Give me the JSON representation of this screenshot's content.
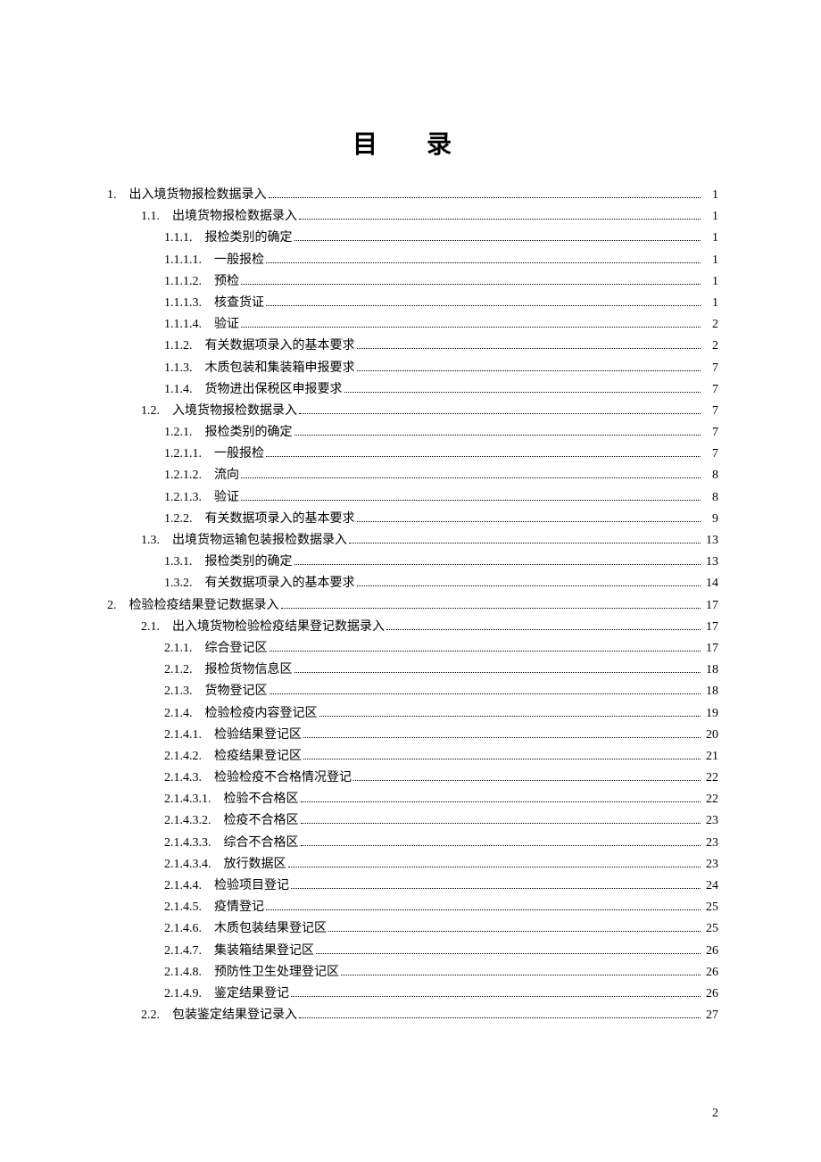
{
  "title": "目 录",
  "page_number": "2",
  "toc": [
    {
      "indent": 0,
      "num": "1.",
      "label": "出入境货物报检数据录入",
      "page": "1"
    },
    {
      "indent": 1,
      "num": "1.1.",
      "label": "出境货物报检数据录入",
      "page": "1"
    },
    {
      "indent": 2,
      "num": "1.1.1.",
      "label": "报检类别的确定",
      "page": "1"
    },
    {
      "indent": 3,
      "num": "1.1.1.1.",
      "label": "一般报检",
      "page": "1"
    },
    {
      "indent": 3,
      "num": "1.1.1.2.",
      "label": "预检",
      "page": "1"
    },
    {
      "indent": 3,
      "num": "1.1.1.3.",
      "label": "核查货证",
      "page": "1"
    },
    {
      "indent": 3,
      "num": "1.1.1.4.",
      "label": "验证",
      "page": "2"
    },
    {
      "indent": 2,
      "num": "1.1.2.",
      "label": "有关数据项录入的基本要求",
      "page": "2"
    },
    {
      "indent": 2,
      "num": "1.1.3.",
      "label": "木质包装和集装箱申报要求",
      "page": "7"
    },
    {
      "indent": 2,
      "num": "1.1.4.",
      "label": "货物进出保税区申报要求",
      "page": "7"
    },
    {
      "indent": 1,
      "num": "1.2.",
      "label": "入境货物报检数据录入",
      "page": "7"
    },
    {
      "indent": 2,
      "num": "1.2.1.",
      "label": "报检类别的确定",
      "page": "7"
    },
    {
      "indent": 3,
      "num": "1.2.1.1.",
      "label": "一般报检",
      "page": "7"
    },
    {
      "indent": 3,
      "num": "1.2.1.2.",
      "label": "流向",
      "page": "8"
    },
    {
      "indent": 3,
      "num": "1.2.1.3.",
      "label": "验证",
      "page": "8"
    },
    {
      "indent": 2,
      "num": "1.2.2.",
      "label": "有关数据项录入的基本要求",
      "page": "9"
    },
    {
      "indent": 1,
      "num": "1.3.",
      "label": "出境货物运输包装报检数据录入",
      "page": "13"
    },
    {
      "indent": 2,
      "num": "1.3.1.",
      "label": "报检类别的确定",
      "page": "13"
    },
    {
      "indent": 2,
      "num": "1.3.2.",
      "label": "有关数据项录入的基本要求",
      "page": "14"
    },
    {
      "indent": 0,
      "num": "2.",
      "label": "检验检疫结果登记数据录入",
      "page": "17"
    },
    {
      "indent": 1,
      "num": "2.1.",
      "label": "出入境货物检验检疫结果登记数据录入",
      "page": "17"
    },
    {
      "indent": 2,
      "num": "2.1.1.",
      "label": "综合登记区",
      "page": "17"
    },
    {
      "indent": 2,
      "num": "2.1.2.",
      "label": "报检货物信息区",
      "page": "18"
    },
    {
      "indent": 2,
      "num": "2.1.3.",
      "label": "货物登记区",
      "page": "18"
    },
    {
      "indent": 2,
      "num": "2.1.4.",
      "label": "检验检疫内容登记区",
      "page": "19"
    },
    {
      "indent": 3,
      "num": "2.1.4.1.",
      "label": "检验结果登记区",
      "page": "20"
    },
    {
      "indent": 3,
      "num": "2.1.4.2.",
      "label": "检疫结果登记区",
      "page": "21"
    },
    {
      "indent": 3,
      "num": "2.1.4.3.",
      "label": "检验检疫不合格情况登记",
      "page": "22"
    },
    {
      "indent": 4,
      "num": "2.1.4.3.1.",
      "label": "检验不合格区",
      "page": "22"
    },
    {
      "indent": 4,
      "num": "2.1.4.3.2.",
      "label": "检疫不合格区",
      "page": "23"
    },
    {
      "indent": 4,
      "num": "2.1.4.3.3.",
      "label": "综合不合格区",
      "page": "23"
    },
    {
      "indent": 4,
      "num": "2.1.4.3.4.",
      "label": "放行数据区",
      "page": "23"
    },
    {
      "indent": 3,
      "num": "2.1.4.4.",
      "label": "检验项目登记",
      "page": "24"
    },
    {
      "indent": 3,
      "num": "2.1.4.5.",
      "label": "疫情登记",
      "page": "25"
    },
    {
      "indent": 3,
      "num": "2.1.4.6.",
      "label": "木质包装结果登记区",
      "page": "25"
    },
    {
      "indent": 3,
      "num": "2.1.4.7.",
      "label": "集装箱结果登记区",
      "page": "26"
    },
    {
      "indent": 3,
      "num": "2.1.4.8.",
      "label": "预防性卫生处理登记区",
      "page": "26"
    },
    {
      "indent": 3,
      "num": "2.1.4.9.",
      "label": "鉴定结果登记",
      "page": "26"
    },
    {
      "indent": 1,
      "num": "2.2.",
      "label": "包装鉴定结果登记录入",
      "page": "27"
    }
  ]
}
